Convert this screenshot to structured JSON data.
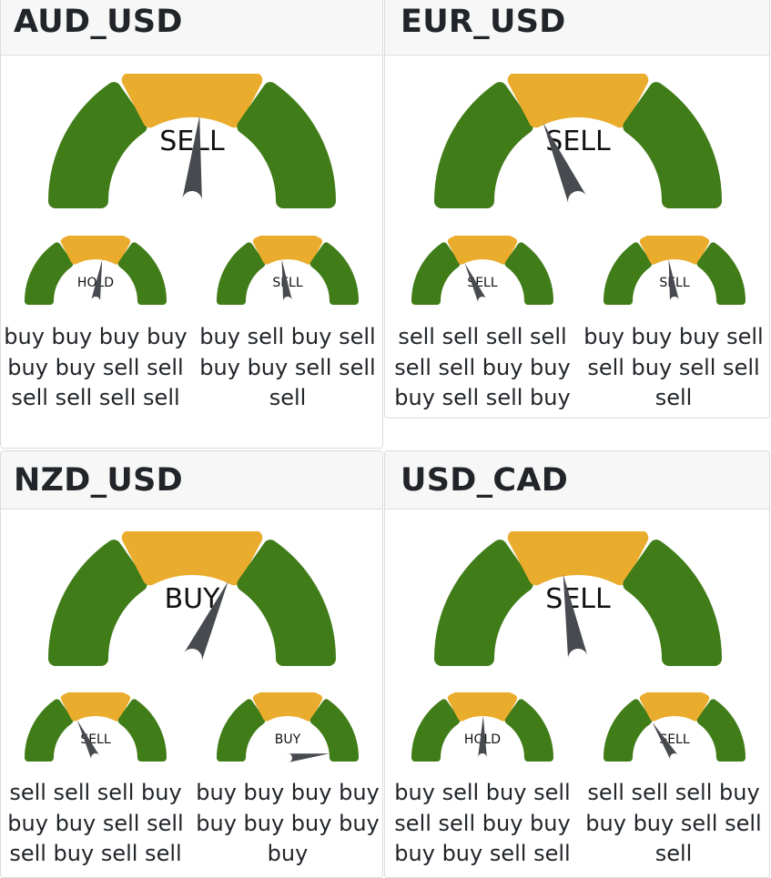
{
  "colors": {
    "green": "#407c18",
    "yellow": "#eaac2c",
    "needle": "#474a4f",
    "header_bg": "#f7f7f7",
    "border": "#dcdcdc"
  },
  "cards": [
    {
      "title": "AUD_USD",
      "main": {
        "label": "SELL",
        "needle_deg": 95
      },
      "sub": [
        {
          "label": "HOLD",
          "needle_deg": 99,
          "signals": "buy buy buy buy buy buy sell sell sell sell sell sell"
        },
        {
          "label": "SELL",
          "needle_deg": 82,
          "signals": "buy sell buy sell buy buy sell sell sell"
        }
      ]
    },
    {
      "title": "EUR_USD",
      "main": {
        "label": "SELL",
        "needle_deg": 66
      },
      "sub": [
        {
          "label": "SELL",
          "needle_deg": 65,
          "signals": "sell sell sell sell sell sell buy buy buy sell sell buy"
        },
        {
          "label": "SELL",
          "needle_deg": 82,
          "signals": "buy buy buy sell sell buy sell sell sell"
        }
      ]
    },
    {
      "title": "NZD_USD",
      "main": {
        "label": "BUY",
        "needle_deg": 115
      },
      "sub": [
        {
          "label": "SELL",
          "needle_deg": 64,
          "signals": "sell sell sell buy buy buy sell sell sell buy sell sell"
        },
        {
          "label": "BUY",
          "needle_deg": 174,
          "signals": "buy buy buy buy buy buy buy buy buy"
        }
      ]
    },
    {
      "title": "USD_CAD",
      "main": {
        "label": "SELL",
        "needle_deg": 80
      },
      "sub": [
        {
          "label": "HOLD",
          "needle_deg": 91,
          "signals": "buy sell buy sell sell sell buy buy buy buy sell sell"
        },
        {
          "label": "SELL",
          "needle_deg": 58,
          "signals": "sell sell sell buy buy buy sell sell sell"
        }
      ]
    }
  ]
}
